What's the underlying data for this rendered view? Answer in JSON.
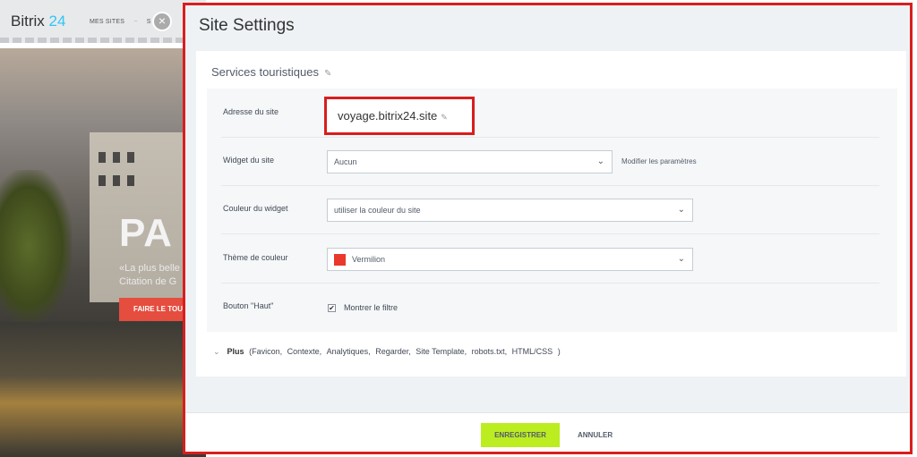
{
  "background_site": {
    "logo_main": "Bitrix",
    "logo_num": "24",
    "nav_items": [
      "MES SITES",
      "S"
    ],
    "hero_title": "PA",
    "hero_subtitle_1": "«La plus belle",
    "hero_subtitle_2": "Citation de G",
    "cta_label": "FAIRE LE TOU",
    "close_label": "×"
  },
  "panel": {
    "title": "Site Settings",
    "site_name": "Services touristiques",
    "pencil": "✎"
  },
  "fields": {
    "address_label": "Adresse du site",
    "address_value": "voyage.bitrix24.site",
    "widget_label": "Widget du site",
    "widget_value": "Aucun",
    "widget_link": "Modifier les paramètres",
    "widget_color_label": "Couleur du widget",
    "widget_color_value": "utiliser la couleur du site",
    "theme_label": "Thème de couleur",
    "theme_value": "Vermilion",
    "top_button_label": "Bouton \"Haut\"",
    "show_filter_label": "Montrer le filtre",
    "show_filter_checked": true
  },
  "more": {
    "label": "Plus",
    "items": [
      "Favicon,",
      "Contexte,",
      "Analytiques,",
      "Regarder,",
      "Site Template,",
      "robots.txt,",
      "HTML/CSS"
    ],
    "open": "(",
    "close": ")"
  },
  "footer": {
    "save_label": "ENREGISTRER",
    "cancel_label": "ANNULER"
  },
  "colors": {
    "accent_highlight": "#d81e1e",
    "save_button": "#bbed21",
    "vermilion": "#e9382c"
  },
  "icons": {
    "chevron": "⌄",
    "check": "✔",
    "expand": "⌄"
  }
}
